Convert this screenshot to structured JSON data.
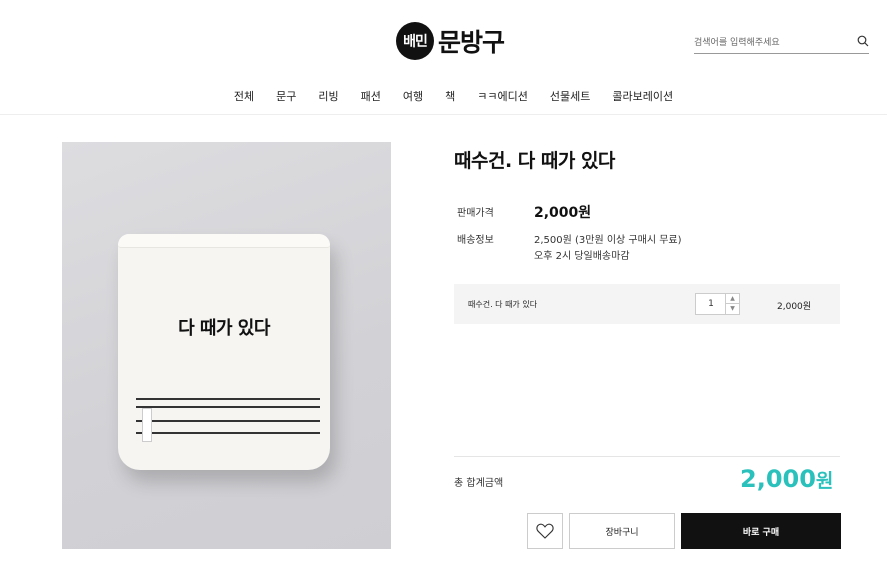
{
  "header": {
    "logo_badge": "배민",
    "logo_text": "문방구",
    "search_placeholder": "검색어를 입력해주세요",
    "search_icon": "search-icon"
  },
  "nav": {
    "items": [
      {
        "label": "전체"
      },
      {
        "label": "문구"
      },
      {
        "label": "리빙"
      },
      {
        "label": "패션"
      },
      {
        "label": "여행"
      },
      {
        "label": "책"
      },
      {
        "label": "ㅋㅋ에디션"
      },
      {
        "label": "선물세트"
      },
      {
        "label": "콜라보레이션"
      }
    ]
  },
  "product": {
    "image_text": "다 때가 있다",
    "title": "때수건. 다 때가 있다",
    "price_label": "판매가격",
    "price": "2,000원",
    "shipping_label": "배송정보",
    "shipping_line1": "2,500원  (3만원 이상 구매시 무료)",
    "shipping_line2": "오후 2시 당일배송마감"
  },
  "option": {
    "name": "때수건. 다 때가 있다",
    "quantity": "1",
    "price": "2,000원"
  },
  "total": {
    "label": "총 합계금액",
    "amount": "2,000",
    "currency": "원"
  },
  "actions": {
    "wishlist_icon": "heart-icon",
    "cart_label": "장바구니",
    "buy_label": "바로 구매"
  },
  "colors": {
    "accent": "#2ac1bc",
    "buy_button": "#111111"
  }
}
